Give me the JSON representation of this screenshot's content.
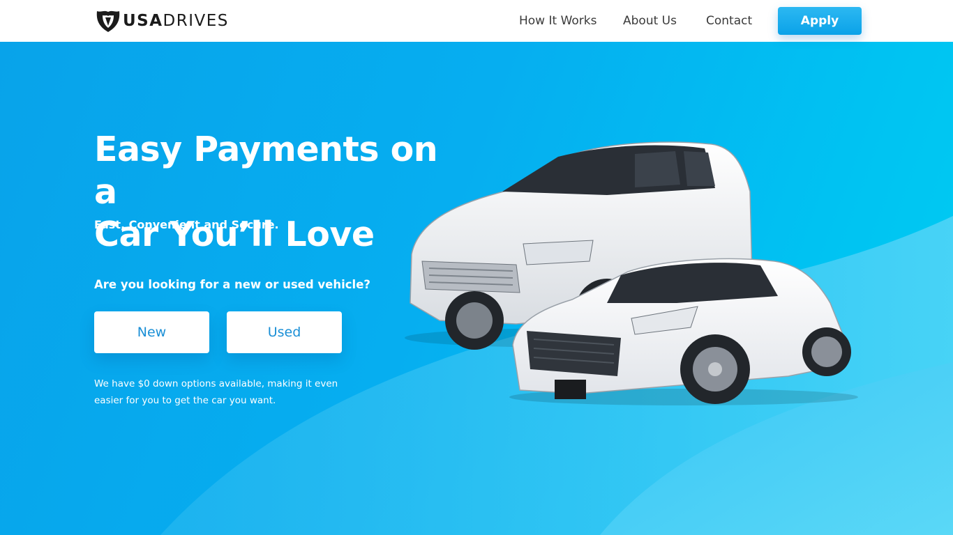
{
  "header": {
    "logo": {
      "bold": "USA",
      "light": "DRIVES"
    },
    "nav": [
      {
        "label": "How It Works"
      },
      {
        "label": "About Us"
      },
      {
        "label": "Contact"
      }
    ],
    "apply_label": "Apply"
  },
  "hero": {
    "title_line1": "Easy Payments on a",
    "title_line2": "Car You’ll Love",
    "subtitle": "Fast, Convenient and Secure.",
    "question": "Are you looking for a new or used vehicle?",
    "options": [
      {
        "label": "New"
      },
      {
        "label": "Used"
      }
    ],
    "note": "We have $0 down options available, making it even easier for you to get the car you want."
  },
  "colors": {
    "brand_blue": "#0aa2e8",
    "button_text": "#1a8fd6",
    "nav_text": "#3a3a3a"
  },
  "icons": [
    "shield-logo-icon"
  ]
}
